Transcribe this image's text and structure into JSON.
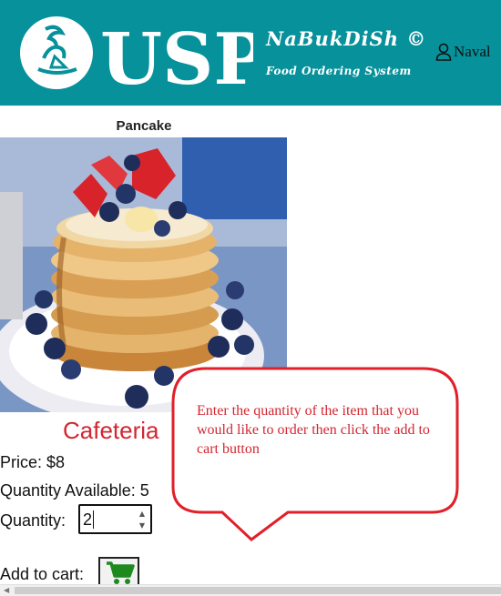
{
  "header": {
    "logo_text": "USP",
    "brand_title": "NaBukDiSh ©",
    "brand_subtitle": "Food Ordering System",
    "user_name": "Naval",
    "icons": {
      "logo": "usp-logo-icon",
      "user": "user-icon"
    },
    "background_color": "#06919b"
  },
  "item": {
    "name": "Pancake",
    "location": "Cafeteria",
    "price_label": "Price: $8",
    "quantity_available_label": "Quantity Available: 5",
    "quantity_label": "Quantity:",
    "quantity_value": "2",
    "add_to_cart_label": "Add to cart:",
    "icons": {
      "cart": "shopping-cart-icon",
      "image": "pancake-image"
    }
  },
  "tooltip": {
    "text": "Enter the quantity of the item that you would like to order then click the add to cart button",
    "border_color": "#e0202a",
    "text_color": "#d32630"
  },
  "colors": {
    "accent_red": "#d32630",
    "cart_green": "#1e8a1e"
  }
}
